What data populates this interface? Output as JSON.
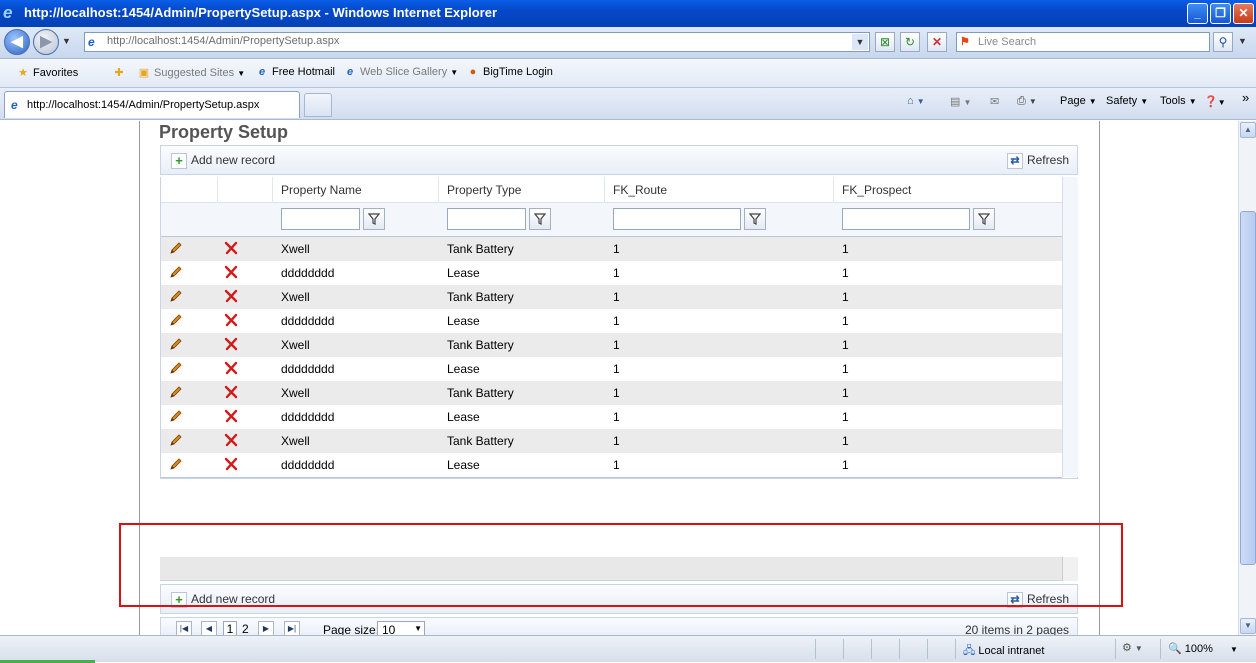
{
  "window": {
    "title": "http://localhost:1454/Admin/PropertySetup.aspx - Windows Internet Explorer",
    "icon": "ie-logo-icon"
  },
  "address_bar": {
    "url": "http://localhost:1454/Admin/PropertySetup.aspx"
  },
  "search": {
    "placeholder": "Live Search"
  },
  "favorites_bar": {
    "favorites_label": "Favorites",
    "items": [
      "Suggested Sites",
      "Free Hotmail",
      "Web Slice Gallery",
      "BigTime Login"
    ]
  },
  "tab": {
    "title": "http://localhost:1454/Admin/PropertySetup.aspx"
  },
  "command_bar": {
    "page": "Page",
    "safety": "Safety",
    "tools": "Tools"
  },
  "page": {
    "title": "Property Setup",
    "add_new_record": "Add new record",
    "refresh": "Refresh"
  },
  "grid": {
    "columns": [
      "Property Name",
      "Property Type",
      "FK_Route",
      "FK_Prospect"
    ],
    "rows": [
      {
        "name": "Xwell",
        "type": "Tank Battery",
        "route": "1",
        "prospect": "1"
      },
      {
        "name": "dddddddd",
        "type": "Lease",
        "route": "1",
        "prospect": "1"
      },
      {
        "name": "Xwell",
        "type": "Tank Battery",
        "route": "1",
        "prospect": "1"
      },
      {
        "name": "dddddddd",
        "type": "Lease",
        "route": "1",
        "prospect": "1"
      },
      {
        "name": "Xwell",
        "type": "Tank Battery",
        "route": "1",
        "prospect": "1"
      },
      {
        "name": "dddddddd",
        "type": "Lease",
        "route": "1",
        "prospect": "1"
      },
      {
        "name": "Xwell",
        "type": "Tank Battery",
        "route": "1",
        "prospect": "1"
      },
      {
        "name": "dddddddd",
        "type": "Lease",
        "route": "1",
        "prospect": "1"
      },
      {
        "name": "Xwell",
        "type": "Tank Battery",
        "route": "1",
        "prospect": "1"
      },
      {
        "name": "dddddddd",
        "type": "Lease",
        "route": "1",
        "prospect": "1"
      }
    ]
  },
  "pager": {
    "pages": [
      "1",
      "2"
    ],
    "current_page": "1",
    "page_size_label": "Page size:",
    "page_size": "10",
    "info": "20 items in 2 pages"
  },
  "status_bar": {
    "zone": "Local intranet",
    "zoom": "100%"
  },
  "colors": {
    "annotation_box": "#dd1111",
    "title_bar": "#0548c8",
    "alt_row": "#ebebeb"
  }
}
